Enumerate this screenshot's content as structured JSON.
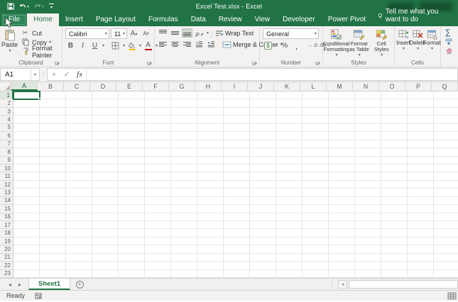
{
  "colors": {
    "accent_green": "#217346",
    "ribbon_bg": "#f3f2f1",
    "font_color_red": "#c00000",
    "fill_color_yellow": "#ffc000"
  },
  "title_bar": {
    "title": "Excel Test.xlsx - Excel"
  },
  "ribbon_tabs": {
    "file": "File",
    "items": [
      "Home",
      "Insert",
      "Page Layout",
      "Formulas",
      "Data",
      "Review",
      "View",
      "Developer",
      "Power Pivot"
    ],
    "active": "Home",
    "tell_me": "Tell me what you want to do"
  },
  "ribbon": {
    "clipboard": {
      "group_label": "Clipboard",
      "paste_label": "Paste",
      "cut_label": "Cut",
      "copy_label": "Copy",
      "format_painter_label": "Format Painter",
      "cut_icon": "✂"
    },
    "font": {
      "group_label": "Font",
      "font_name_value": "Calibri",
      "font_size_value": "11",
      "bold_label": "B",
      "italic_label": "I",
      "underline_label": "U",
      "grow_font_label": "A",
      "shrink_font_label": "A",
      "font_color_label": "A"
    },
    "alignment": {
      "group_label": "Alignment",
      "wrap_text_label": "Wrap Text",
      "merge_center_label": "Merge & Center"
    },
    "number": {
      "group_label": "Number",
      "number_format_value": "General",
      "accounting_label": "$",
      "percent_label": "%",
      "comma_label": ",",
      "increase_decimal_label": "←.0",
      "decrease_decimal_label": ".00→"
    },
    "styles": {
      "group_label": "Styles",
      "conditional_formatting_label": "Conditional Formatting",
      "format_as_table_label": "Format as Table",
      "cell_styles_label": "Cell Styles"
    },
    "cells": {
      "group_label": "Cells",
      "insert_label": "Insert",
      "delete_label": "Delete",
      "format_label": "Format"
    },
    "editing": {
      "autosum_icon": "∑"
    }
  },
  "formula_bar": {
    "name_box_value": "A1",
    "cancel_icon": "×",
    "enter_icon": "✓",
    "insert_function_label": "fx",
    "formula_value": ""
  },
  "grid": {
    "selected_cell": "A1",
    "selected_column": "A",
    "selected_row": "1",
    "columns": [
      "A",
      "B",
      "C",
      "D",
      "E",
      "F",
      "G",
      "H",
      "I",
      "J",
      "K",
      "L",
      "M",
      "N",
      "O",
      "P",
      "Q"
    ],
    "rows": [
      "1",
      "2",
      "3",
      "4",
      "5",
      "6",
      "7",
      "8",
      "9",
      "10",
      "11",
      "12",
      "13",
      "14",
      "15",
      "16",
      "17",
      "18",
      "19",
      "20",
      "21",
      "22",
      "23"
    ]
  },
  "sheet_bar": {
    "tabs": [
      {
        "label": "Sheet1"
      }
    ],
    "active_tab": "Sheet1",
    "new_sheet_label": "+",
    "prev_icon": "◂",
    "next_icon": "▸",
    "scroll_left_icon": "◂",
    "splitter_icon": "⋮"
  },
  "status_bar": {
    "status": "Ready"
  }
}
